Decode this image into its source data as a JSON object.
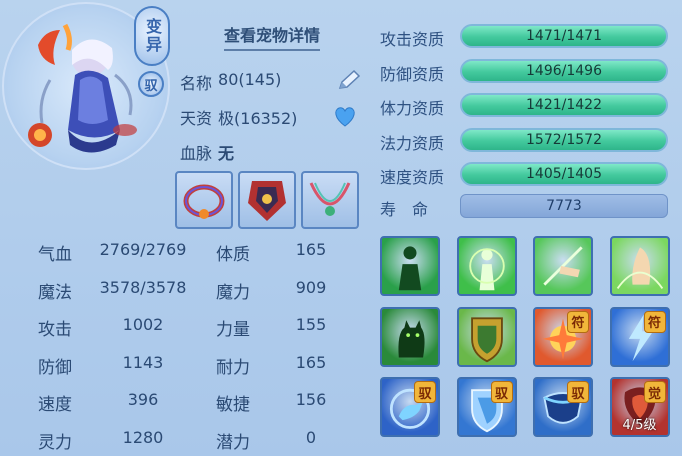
{
  "pet": {
    "variant_badge": "变异",
    "yu_badge": "驭",
    "detail_link": "查看宠物详情",
    "name_label": "名称",
    "name_value": "80(145)",
    "talent_label": "天资",
    "talent_value": "极(16352)",
    "bloodline_label": "血脉",
    "bloodline_value": "无"
  },
  "stats": [
    {
      "label": "气血",
      "value": "2769/2769",
      "attr_label": "体质",
      "attr_value": "165"
    },
    {
      "label": "魔法",
      "value": "3578/3578",
      "attr_label": "魔力",
      "attr_value": "909"
    },
    {
      "label": "攻击",
      "value": "1002",
      "attr_label": "力量",
      "attr_value": "155"
    },
    {
      "label": "防御",
      "value": "1143",
      "attr_label": "耐力",
      "attr_value": "165"
    },
    {
      "label": "速度",
      "value": "396",
      "attr_label": "敏捷",
      "attr_value": "156"
    },
    {
      "label": "灵力",
      "value": "1280",
      "attr_label": "潜力",
      "attr_value": "0"
    }
  ],
  "aptitudes": [
    {
      "label": "攻击资质",
      "value": "1471/1471",
      "fraction": 1.0
    },
    {
      "label": "防御资质",
      "value": "1496/1496",
      "fraction": 1.0
    },
    {
      "label": "体力资质",
      "value": "1421/1422",
      "fraction": 0.999
    },
    {
      "label": "法力资质",
      "value": "1572/1572",
      "fraction": 1.0
    },
    {
      "label": "速度资质",
      "value": "1405/1405",
      "fraction": 1.0
    }
  ],
  "lifespan": {
    "label": "寿　命",
    "value": "7773"
  },
  "skills": [
    {
      "icon": "green-body-icon",
      "tag": ""
    },
    {
      "icon": "green-light-figure-icon",
      "tag": ""
    },
    {
      "icon": "green-hand-slash-icon",
      "tag": ""
    },
    {
      "icon": "green-palm-icon",
      "tag": ""
    },
    {
      "icon": "green-cat-shadow-icon",
      "tag": ""
    },
    {
      "icon": "gold-shield-icon",
      "tag": ""
    },
    {
      "icon": "red-burst-icon",
      "tag": "符"
    },
    {
      "icon": "blue-lightning-icon",
      "tag": "符"
    },
    {
      "icon": "blue-beast-icon",
      "tag": "驭"
    },
    {
      "icon": "blue-shield-icon",
      "tag": "驭"
    },
    {
      "icon": "blue-shield-half-icon",
      "tag": "驭"
    },
    {
      "icon": "red-awaken-icon",
      "tag": "觉",
      "level": "4/5级"
    }
  ],
  "colors": {
    "aptitude_bar": "#43c99d",
    "lifespan_bar": "#84a6d8",
    "tag_bg": "#f1b63a",
    "accent": "#3e6fb0"
  }
}
